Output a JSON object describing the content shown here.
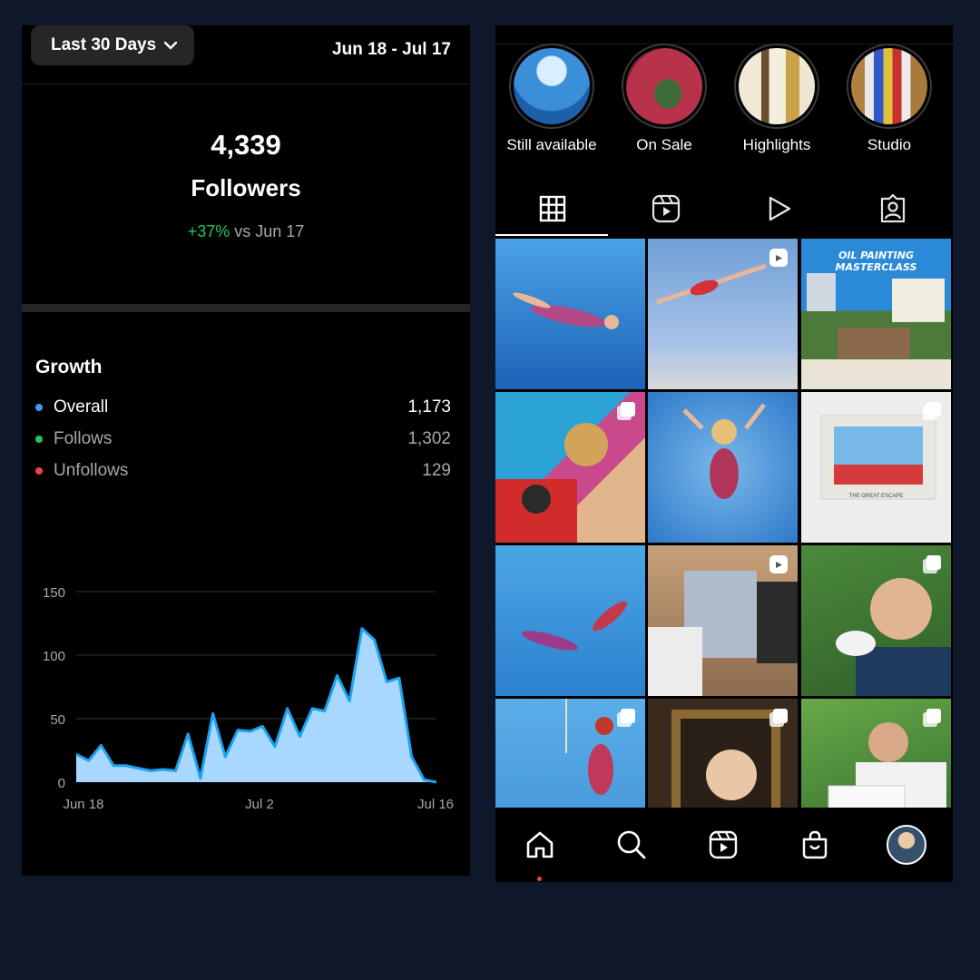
{
  "insights": {
    "range_button": "Last 30 Days",
    "date_range": "Jun 18 - Jul 17",
    "followers_count": "4,339",
    "followers_label": "Followers",
    "change_pct": "+37%",
    "change_text": " vs Jun 17",
    "growth_title": "Growth",
    "growth_rows": [
      {
        "label": "Overall",
        "value": "1,173",
        "color": "#3b9cff"
      },
      {
        "label": "Follows",
        "value": "1,302",
        "color": "#22c55e"
      },
      {
        "label": "Unfollows",
        "value": "129",
        "color": "#ef4444"
      }
    ]
  },
  "chart_data": {
    "type": "area",
    "x_ticks": [
      "Jun 18",
      "Jul 2",
      "Jul 16"
    ],
    "y_ticks": [
      0,
      50,
      100,
      150
    ],
    "ylim": [
      0,
      150
    ],
    "grid": true,
    "fill_color": "#a8d8ff",
    "line_color": "#1aa3f0",
    "x": [
      1,
      2,
      3,
      4,
      5,
      6,
      7,
      8,
      9,
      10,
      11,
      12,
      13,
      14,
      15,
      16,
      17,
      18,
      19,
      20,
      21,
      22,
      23,
      24,
      25,
      26,
      27,
      28,
      29,
      30
    ],
    "values": [
      22,
      17,
      29,
      13,
      13,
      11,
      9,
      10,
      9,
      38,
      3,
      54,
      20,
      41,
      40,
      44,
      28,
      58,
      36,
      58,
      56,
      84,
      64,
      121,
      112,
      79,
      82,
      20,
      2,
      0
    ]
  },
  "profile": {
    "highlights": [
      {
        "label": "Still available"
      },
      {
        "label": "On Sale"
      },
      {
        "label": "Highlights"
      },
      {
        "label": "Studio"
      }
    ],
    "tabs": [
      "grid-icon",
      "reels-icon",
      "play-icon",
      "tagged-icon"
    ],
    "nav": [
      "home-icon",
      "search-icon",
      "reels-icon",
      "shop-icon",
      "profile-avatar"
    ]
  },
  "grid_posts": [
    {
      "name": "post-underwater-swimmer",
      "badge": "none",
      "text": ""
    },
    {
      "name": "post-diver",
      "badge": "reel",
      "text": ""
    },
    {
      "name": "post-masterclass",
      "badge": "reel",
      "text": "OIL PAINTING MASTERCLASS"
    },
    {
      "name": "post-record-player",
      "badge": "multi",
      "text": ""
    },
    {
      "name": "post-jumping-woman",
      "badge": "none",
      "text": ""
    },
    {
      "name": "post-great-escape",
      "badge": "multi",
      "text": "THE GREAT ESCAPE"
    },
    {
      "name": "post-two-divers",
      "badge": "none",
      "text": ""
    },
    {
      "name": "post-studio-painting",
      "badge": "reel",
      "text": ""
    },
    {
      "name": "post-guinea-pig",
      "badge": "multi",
      "text": ""
    },
    {
      "name": "post-rope-woman",
      "badge": "multi",
      "text": ""
    },
    {
      "name": "post-child-portrait",
      "badge": "multi",
      "text": ""
    },
    {
      "name": "post-artist-print",
      "badge": "multi",
      "text": ""
    }
  ]
}
